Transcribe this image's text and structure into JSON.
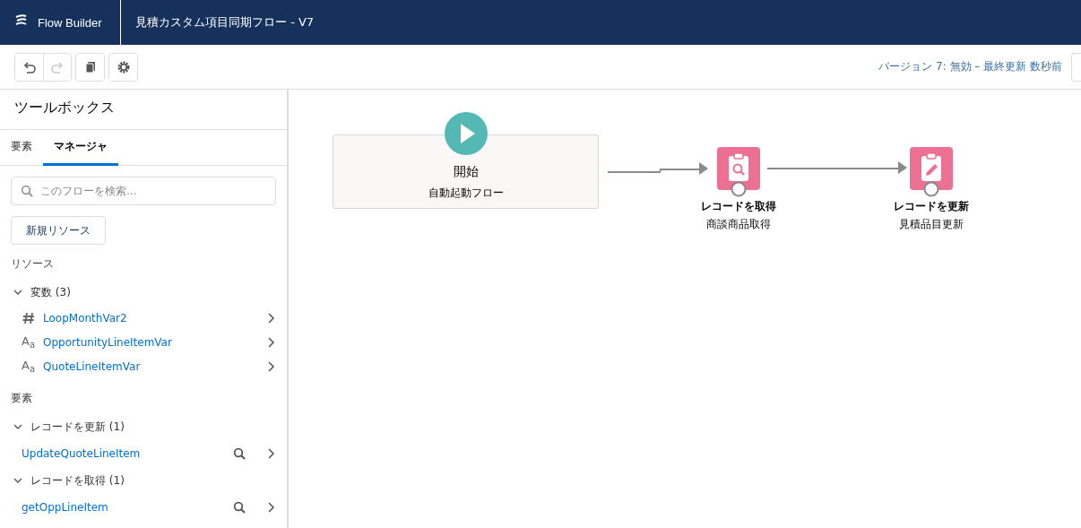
{
  "header": {
    "app_name": "Flow Builder",
    "flow_title": "見積カスタム項目同期フロー - V7"
  },
  "toolbar": {
    "buttons": [
      {
        "kind": "undo",
        "disabled": false
      },
      {
        "kind": "redo",
        "disabled": true
      },
      {
        "kind": "copy",
        "disabled": false
      },
      {
        "kind": "settings",
        "disabled": false
      }
    ],
    "status": "バージョン 7: 無効 – 最終更新 数秒前"
  },
  "sidebar": {
    "title": "ツールボックス",
    "tabs": [
      {
        "label": "要素",
        "selected": false
      },
      {
        "label": "マネージャ",
        "selected": true
      }
    ],
    "search": {
      "placeholder": "このフローを検索..."
    },
    "new_button": "新規リソース",
    "resources_label": "リソース",
    "resource_groups": [
      {
        "label": "変数 (3)",
        "expanded": true,
        "children": [
          {
            "name": "LoopMonthVar2",
            "kind": "number"
          },
          {
            "name": "OpportunityLineItemVar",
            "kind": "text",
            "type_glyph": "A$_{a}$"
          },
          {
            "name": "QuoteLineItemVar",
            "kind": "text",
            "type_glyph": "A$_{a}$"
          }
        ]
      }
    ],
    "elements_label": "要素",
    "element_groups": [
      {
        "label": "レコードを更新 (1)",
        "expanded": true,
        "children": [
          {
            "name": "UpdateQuoteLineItem"
          }
        ]
      },
      {
        "label": "レコードを取得 (1)",
        "expanded": true,
        "children": [
          {
            "name": "getOppLineItem"
          }
        ]
      }
    ]
  },
  "canvas": {
    "start": {
      "title": "開始",
      "subtitle": "自動起動フロー"
    },
    "nodes": [
      {
        "kind": "get_records",
        "title": "レコードを取得",
        "subtitle": "商談商品取得"
      },
      {
        "kind": "update_records",
        "title": "レコードを更新",
        "subtitle": "見積品目更新"
      }
    ]
  }
}
